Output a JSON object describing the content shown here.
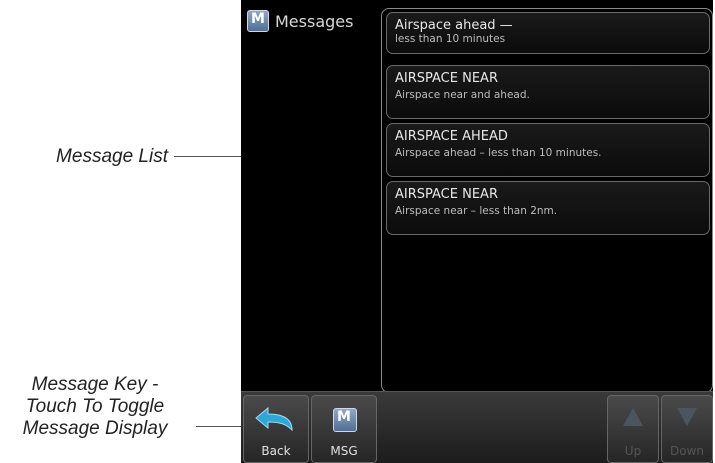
{
  "callouts": {
    "message_list": "Message List",
    "message_key_line1": "Message Key -",
    "message_key_line2": "Touch To Toggle",
    "message_key_line3": "Message Display"
  },
  "header": {
    "title": "Messages",
    "icon": "msg-icon"
  },
  "messages": [
    {
      "title": "Airspace ahead —",
      "detail": "less than 10 minutes"
    },
    {
      "title": "AIRSPACE NEAR",
      "detail": "Airspace near and ahead."
    },
    {
      "title": "AIRSPACE AHEAD",
      "detail": "Airspace ahead – less than 10 minutes."
    },
    {
      "title": "AIRSPACE NEAR",
      "detail": "Airspace near – less than 2nm."
    }
  ],
  "footer": {
    "back_label": "Back",
    "msg_label": "MSG",
    "up_label": "Up",
    "down_label": "Down"
  },
  "colors": {
    "screen_bg": "#000000",
    "icon_blue": "#4f6f95",
    "text": "#e8e8e8"
  }
}
